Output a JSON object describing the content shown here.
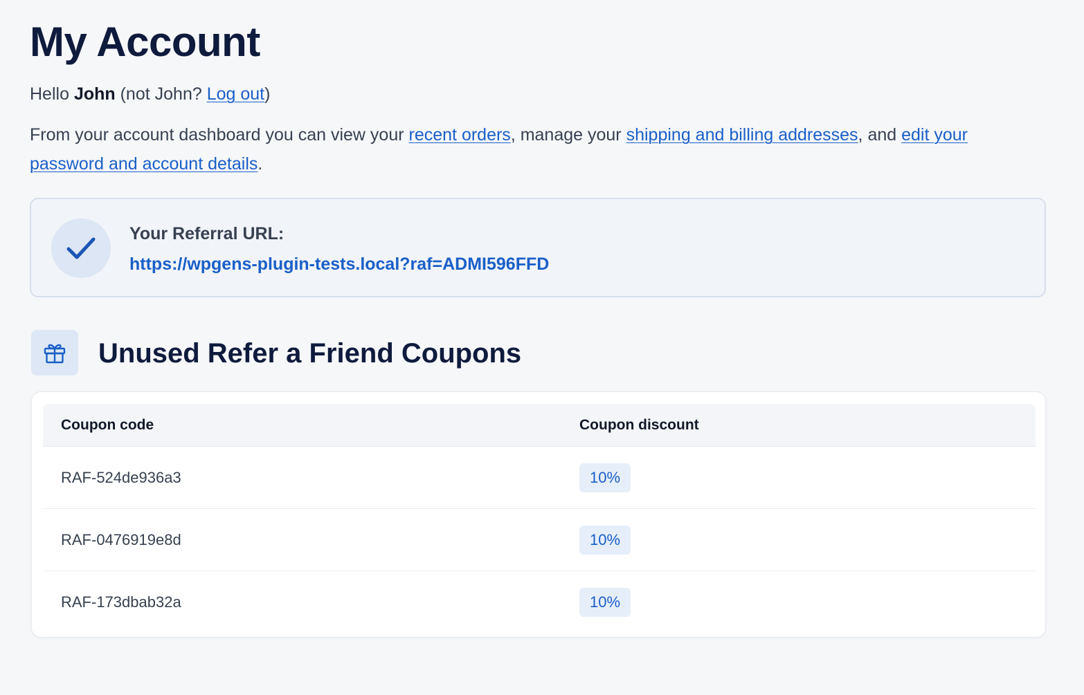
{
  "page": {
    "title": "My Account"
  },
  "greeting": {
    "hello": "Hello",
    "username": "John",
    "not_user_prefix": "(not John?",
    "logout_label": "Log out",
    "not_user_suffix": ")"
  },
  "intro": {
    "text_1": "From your account dashboard you can view your",
    "link_orders": "recent orders",
    "text_2": ", manage your",
    "link_addresses": "shipping and billing addresses",
    "text_3": ", and",
    "link_account": "edit your password and account details",
    "text_4": "."
  },
  "referral": {
    "label": "Your Referral URL:",
    "url": "https://wpgens-plugin-tests.local?raf=ADMI596FFD",
    "icon": "check-icon"
  },
  "coupons": {
    "icon": "gift-icon",
    "title": "Unused Refer a Friend Coupons",
    "columns": [
      "Coupon code",
      "Coupon discount"
    ],
    "rows": [
      {
        "code": "RAF-524de936a3",
        "discount": "10%"
      },
      {
        "code": "RAF-0476919e8d",
        "discount": "10%"
      },
      {
        "code": "RAF-173dbab32a",
        "discount": "10%"
      }
    ]
  },
  "colors": {
    "background": "#f6f7f9",
    "heading": "#0f1b3d",
    "link": "#1a5fc8",
    "badge_bg": "#e6eef9"
  }
}
